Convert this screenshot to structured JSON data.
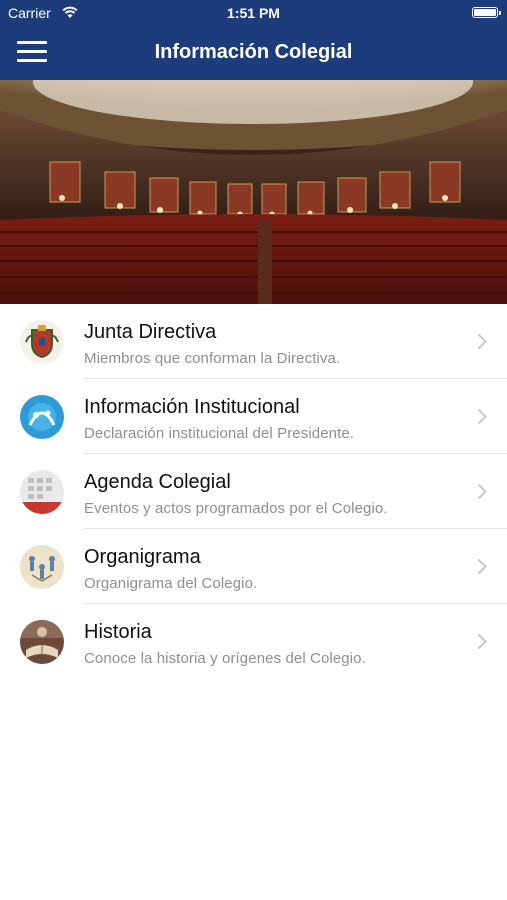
{
  "status": {
    "carrier": "Carrier",
    "time": "1:51 PM"
  },
  "navbar": {
    "title": "Información Colegial",
    "menu_icon": "hamburger-menu-icon"
  },
  "hero": {
    "image": "theater-auditorium-photo"
  },
  "menu": [
    {
      "title": "Junta Directiva",
      "subtitle": "Miembros que conforman la Directiva.",
      "icon": "coat-of-arms-icon"
    },
    {
      "title": "Información Institucional",
      "subtitle": "Declaración institucional del Presidente.",
      "icon": "institution-logo-icon"
    },
    {
      "title": "Agenda Colegial",
      "subtitle": "Eventos y actos programados por el Colegio.",
      "icon": "calendar-photo-icon"
    },
    {
      "title": "Organigrama",
      "subtitle": "Organigrama del Colegio.",
      "icon": "org-chart-photo-icon"
    },
    {
      "title": "Historia",
      "subtitle": "Conoce la historia y orígenes del Colegio.",
      "icon": "history-book-photo-icon"
    }
  ],
  "colors": {
    "navbar": "#1c3c7c",
    "subtitle": "#8e8e93",
    "chevron": "#c7c7cc"
  }
}
